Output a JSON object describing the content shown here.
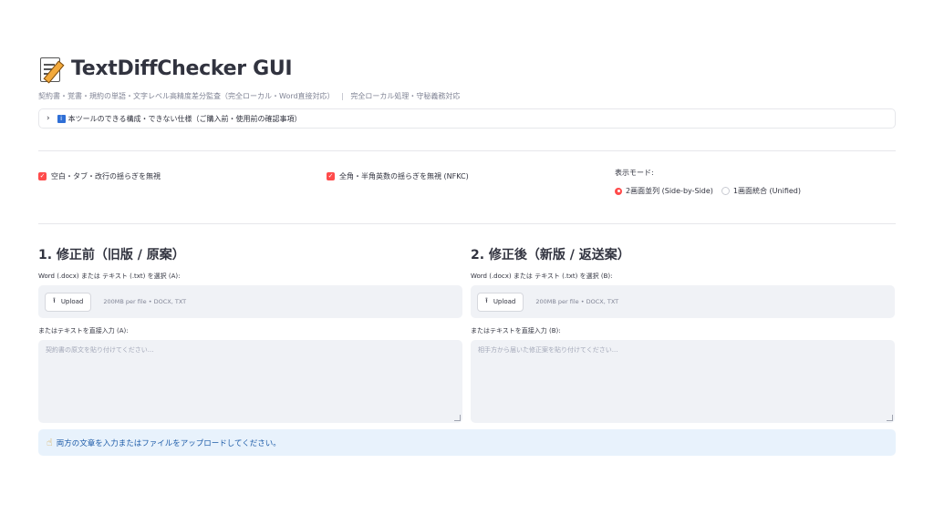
{
  "app": {
    "title": "TextDiffChecker GUI",
    "caption": "契約書・覚書・規約の単語・文字レベル高精度差分監査（完全ローカル・Word直接対応）",
    "caption_sep": "|",
    "caption_tail": "完全ローカル処理・守秘義務対応",
    "title_icon": "memo-icon"
  },
  "expander": {
    "label": "本ツールのできる構成・できない仕様（ご購入前・使用前の確認事項）",
    "icon": "info-icon"
  },
  "options": {
    "ignore_whitespace": {
      "label": "空白・タブ・改行の揺らぎを無視",
      "checked": true
    },
    "ignore_width": {
      "label": "全角・半角英数の揺らぎを無視 (NFKC)",
      "checked": true
    },
    "display_mode": {
      "label": "表示モード:",
      "choices": [
        {
          "label": "2画面並列 (Side-by-Side)",
          "selected": true
        },
        {
          "label": "1画面統合 (Unified)",
          "selected": false
        }
      ]
    }
  },
  "left": {
    "heading": "1. 修正前（旧版 / 原案）",
    "file_label": "Word (.docx) または テキスト (.txt) を選択 (A):",
    "upload_label": "Upload",
    "upload_hint": "200MB per file • DOCX, TXT",
    "text_label": "またはテキストを直接入力 (A):",
    "text_placeholder": "契約書の原文を貼り付けてください..."
  },
  "right": {
    "heading": "2. 修正後（新版 / 返送案）",
    "file_label": "Word (.docx) または テキスト (.txt) を選択 (B):",
    "upload_label": "Upload",
    "upload_hint": "200MB per file • DOCX, TXT",
    "text_label": "またはテキストを直接入力 (B):",
    "text_placeholder": "相手方から届いた修正案を貼り付けてください..."
  },
  "alert": {
    "message": "両方の文章を入力またはファイルをアップロードしてください。",
    "icon": "pointing-hand-icon"
  },
  "colors": {
    "accent": "#ff4b4b",
    "info_bg": "#e8f2fc",
    "info_text": "#1c5ba8",
    "input_bg": "#f0f2f6"
  }
}
